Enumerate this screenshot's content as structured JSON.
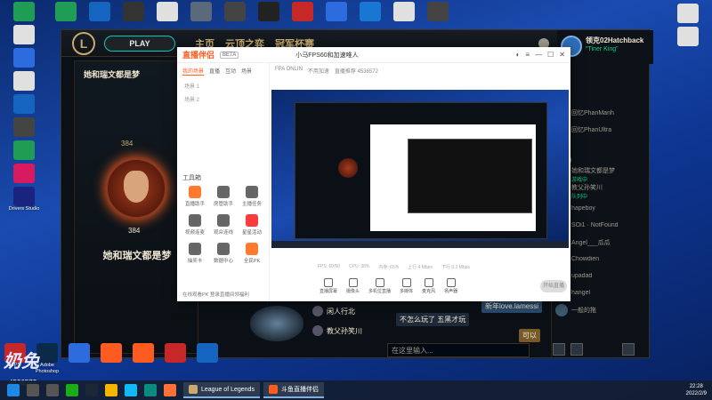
{
  "desktop": {
    "top_row": [
      {
        "label": "",
        "color": "#1f9d55"
      },
      {
        "label": "",
        "color": "#1565c0"
      },
      {
        "label": "",
        "color": "#333"
      },
      {
        "label": "",
        "color": "#e0e0e0"
      },
      {
        "label": "",
        "color": "#5a6a7a"
      },
      {
        "label": "",
        "color": "#444"
      },
      {
        "label": "",
        "color": "#222"
      },
      {
        "label": "",
        "color": "#c62828"
      },
      {
        "label": "",
        "color": "#2d6cdf"
      },
      {
        "label": "",
        "color": "#1976d2"
      },
      {
        "label": "",
        "color": "#e0e0e0"
      },
      {
        "label": "",
        "color": "#444"
      }
    ],
    "left_col": [
      {
        "label": "",
        "color": "#1f9d55"
      },
      {
        "label": "",
        "color": "#e0e0e0"
      },
      {
        "label": "",
        "color": "#2d6cdf"
      },
      {
        "label": "",
        "color": "#e0e0e0"
      },
      {
        "label": "",
        "color": "#1565c0"
      },
      {
        "label": "",
        "color": "#444"
      },
      {
        "label": "",
        "color": "#1f9d55"
      },
      {
        "label": "",
        "color": "#d81b60"
      },
      {
        "label": "Drivers Studio",
        "color": "#1a237e"
      }
    ],
    "right_col": [
      {
        "label": "",
        "color": "#e0e0e0"
      },
      {
        "label": "",
        "color": "#e0e0e0"
      }
    ],
    "dock": [
      {
        "label": "WPS",
        "color": "#c62828"
      },
      {
        "label": "Adobe Photoshop",
        "color": "#0b2a4a"
      },
      {
        "label": "",
        "color": "#2d6cdf"
      },
      {
        "label": "",
        "color": "#ff5a1f"
      },
      {
        "label": "",
        "color": "#ff5a1f"
      },
      {
        "label": "",
        "color": "#c62828"
      },
      {
        "label": "",
        "color": "#1565c0"
      }
    ],
    "overlay_logo": "奶兔",
    "room_number": "4536572"
  },
  "league": {
    "play_label": "PLAY",
    "tabs": [
      "主页",
      "云顶之弈",
      "冠军杯赛"
    ],
    "currency": "0",
    "profile_level": "384",
    "summoner_name": "她和瑞文都是梦",
    "avatar_level": "384",
    "me": {
      "name": "领克02Hatchback",
      "status": "\"Tiner King\""
    },
    "friends_header": "(0/3)",
    "friends": [
      {
        "name": "回忆PhanManh",
        "status": ""
      },
      {
        "name": "回忆PhanUltra",
        "status": ""
      },
      {
        "name": "",
        "status": ""
      }
    ],
    "group2": "(3/31)",
    "friends2": [
      {
        "name": "她和瑞文都是梦",
        "status": "游戏中"
      },
      {
        "name": "教父孙笑川",
        "status": "队列中"
      },
      {
        "name": "hapeboy",
        "status": ""
      },
      {
        "name": "SOi1 · NotFound",
        "status": ""
      },
      {
        "name": "Angel___瓜瓜",
        "status": ""
      },
      {
        "name": "Chowdien",
        "status": ""
      },
      {
        "name": "upadad",
        "status": ""
      },
      {
        "name": "hangel",
        "status": ""
      },
      {
        "name": "一般的拖",
        "status": ""
      }
    ],
    "chat": [
      {
        "name": "闲人行北"
      },
      {
        "name": "教父孙笑川"
      }
    ],
    "chat_msg": "不怎么玩了 五黑才玩",
    "chat_reply": "新年love.lamessi",
    "chat_ok": "可以",
    "chat_placeholder": "在这里输入..."
  },
  "stream": {
    "logo": "直播伴侣",
    "tag": "BETA",
    "room_title": "小马FPS60和加速唯人",
    "room_meta": [
      "FPA ONLIN",
      "不用加速",
      "直播推荐 4536572"
    ],
    "tabs": [
      "我的场景",
      "直播",
      "互动",
      "场景"
    ],
    "scenes": [
      "场景 1",
      "场景 2"
    ],
    "tools_header": "工具箱",
    "tools": [
      {
        "label": "直播助手",
        "color": "#ff7a2f"
      },
      {
        "label": "房管助手",
        "color": "#666"
      },
      {
        "label": "主播任务",
        "color": "#666"
      },
      {
        "label": "视频连麦",
        "color": "#666"
      },
      {
        "label": "观众连线",
        "color": "#666"
      },
      {
        "label": "星星活动",
        "color": "#ff3a3a"
      },
      {
        "label": "抽奖卡",
        "color": "#666"
      },
      {
        "label": "数据中心",
        "color": "#666"
      },
      {
        "label": "全民PK",
        "color": "#ff7a2f"
      }
    ],
    "footer_note": "在线观看PK 登录直播间领福利",
    "toolbar": [
      "直播屏幕",
      "摄像头",
      "多机位直播",
      "多媒体",
      "麦克风",
      "扬声器"
    ],
    "status": [
      "FPS: 60/60",
      "CPU: 38%",
      "内存: 65%",
      "上行 4 Mbps",
      "下行 0.3 Mbps"
    ],
    "start_label": "开始直播"
  },
  "taskbar": {
    "apps": [
      {
        "label": "League of Legends",
        "color": "#c8aa6e"
      },
      {
        "label": "斗鱼直播伴侣",
        "color": "#ff5a1f"
      }
    ],
    "time": "22:28",
    "date": "2022/2/9"
  }
}
